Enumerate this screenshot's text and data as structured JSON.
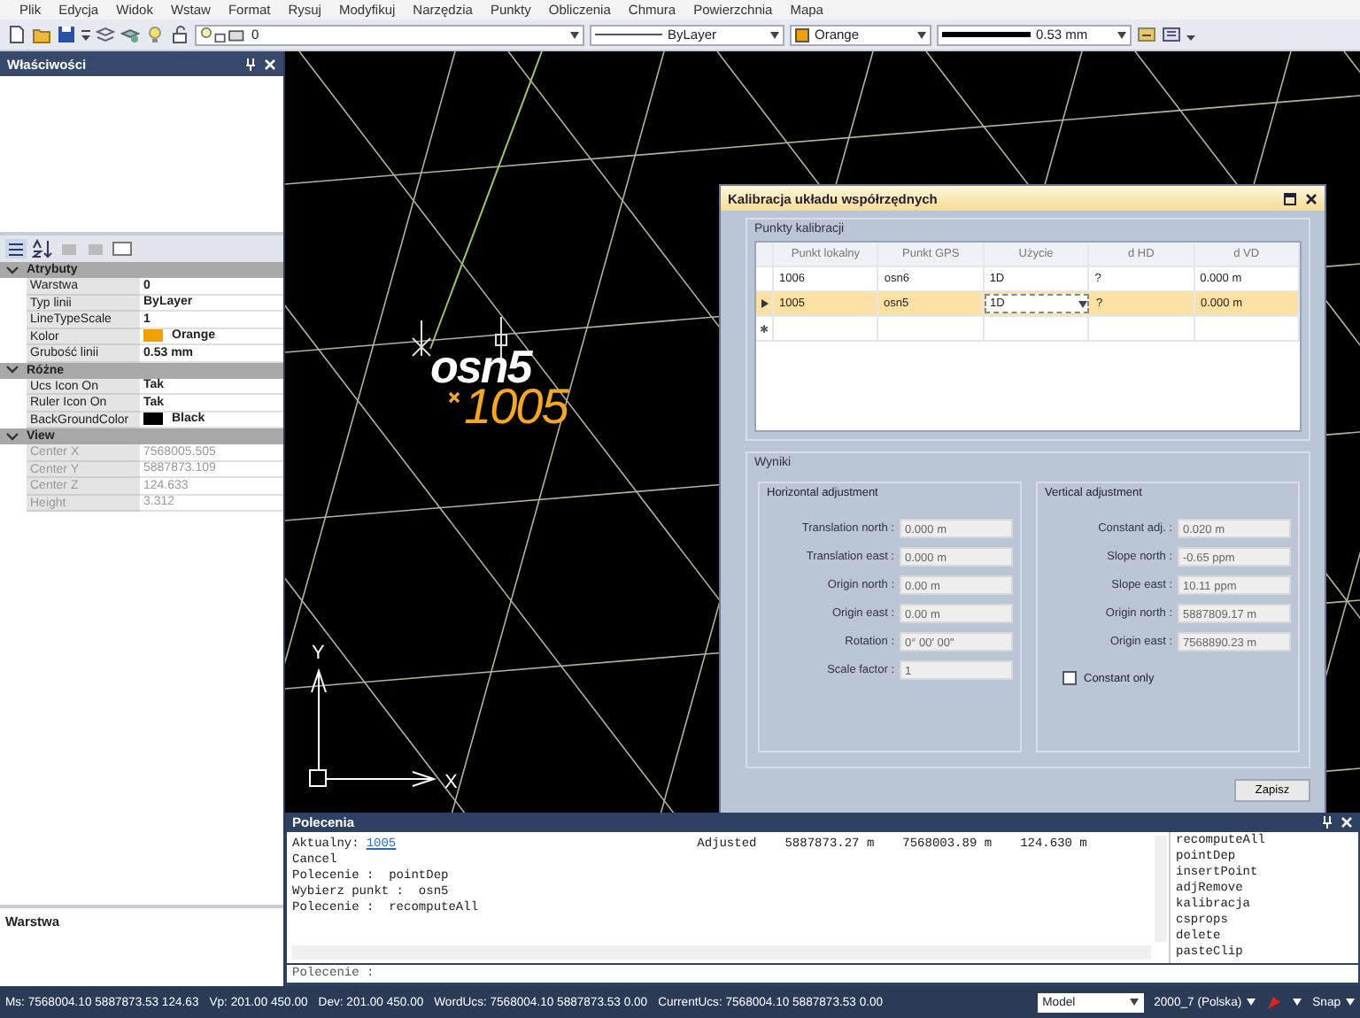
{
  "menu": [
    "Plik",
    "Edycja",
    "Widok",
    "Wstaw",
    "Format",
    "Rysuj",
    "Modyfikuj",
    "Narzędzia",
    "Punkty",
    "Obliczenia",
    "Chmura",
    "Powierzchnia",
    "Mapa"
  ],
  "toolbar": {
    "combos": [
      {
        "kind": "layer",
        "value": "0"
      },
      {
        "kind": "linetype",
        "value": "ByLayer"
      },
      {
        "kind": "color",
        "value": "Orange",
        "color": "#f0a000"
      },
      {
        "kind": "lineweight",
        "value": "0.53 mm"
      }
    ]
  },
  "properties": {
    "title": "Właściwości",
    "sections": [
      {
        "title": "Atrybuty",
        "expanded": true,
        "rows": [
          {
            "name": "Warstwa",
            "value": "0",
            "disabled": false
          },
          {
            "name": "Typ linii",
            "value": "ByLayer",
            "disabled": false
          },
          {
            "name": "LineTypeScale",
            "value": "1",
            "disabled": false
          },
          {
            "name": "Kolor",
            "value": "Orange",
            "disabled": false,
            "color": "#f0a000"
          },
          {
            "name": "Grubość linii",
            "value": "0.53 mm",
            "disabled": false
          }
        ]
      },
      {
        "title": "Różne",
        "expanded": true,
        "rows": [
          {
            "name": "Ucs Icon On",
            "value": "Tak",
            "disabled": false
          },
          {
            "name": "Ruler Icon On",
            "value": "Tak",
            "disabled": false
          },
          {
            "name": "BackGroundColor",
            "value": "Black",
            "disabled": false,
            "color": "#000000"
          }
        ]
      },
      {
        "title": "View",
        "expanded": true,
        "rows": [
          {
            "name": "Center X",
            "value": "7568005.505",
            "disabled": true
          },
          {
            "name": "Center Y",
            "value": "5887873.109",
            "disabled": true
          },
          {
            "name": "Center Z",
            "value": "124.633",
            "disabled": true
          },
          {
            "name": "Height",
            "value": "3.312",
            "disabled": true
          }
        ]
      }
    ]
  },
  "layer_panel": {
    "title": "Warstwa"
  },
  "canvas": {
    "point_name": "osn5",
    "point_number": "1005",
    "axis_y": "Y",
    "axis_x": "X"
  },
  "dialog": {
    "title": "Kalibracja układu współrzędnych",
    "points": {
      "title": "Punkty kalibracji",
      "columns": [
        "Punkt lokalny",
        "Punkt GPS",
        "Użycie",
        "d HD",
        "d VD"
      ],
      "rows": [
        {
          "selected": false,
          "usage_dropdown": false,
          "cells": [
            "1006",
            "osn6",
            "1D",
            "?",
            "0.000 m"
          ]
        },
        {
          "selected": true,
          "usage_dropdown": true,
          "cells": [
            "1005",
            "osn5",
            "1D",
            "?",
            "0.000 m"
          ]
        }
      ],
      "new_row_marker": "✱"
    },
    "results": {
      "title": "Wyniki",
      "horizontal": {
        "title": "Horizontal adjustment",
        "fields": [
          {
            "label": "Translation north :",
            "value": "0.000 m"
          },
          {
            "label": "Translation east :",
            "value": "0.000 m"
          },
          {
            "label": "Origin north :",
            "value": "0.00 m"
          },
          {
            "label": "Origin east :",
            "value": "0.00 m"
          },
          {
            "label": "Rotation :",
            "value": "0° 00' 00\""
          },
          {
            "label": "Scale factor :",
            "value": "1"
          }
        ]
      },
      "vertical": {
        "title": "Vertical adjustment",
        "fields": [
          {
            "label": "Constant adj. :",
            "value": "0.020 m"
          },
          {
            "label": "Slope north :",
            "value": "-0.65 ppm"
          },
          {
            "label": "Slope east :",
            "value": "10.11 ppm"
          },
          {
            "label": "Origin north :",
            "value": "5887809.17 m"
          },
          {
            "label": "Origin east :",
            "value": "7568890.23 m"
          }
        ],
        "checkbox": {
          "label": "Constant only",
          "checked": false
        }
      }
    },
    "button": "Zapisz"
  },
  "commands": {
    "title": "Polecenia",
    "header": {
      "label": "Aktualny:",
      "link": "1005",
      "columns": [
        "Adjusted",
        "5887873.27 m",
        "7568003.89 m",
        "124.630 m"
      ]
    },
    "lines": [
      "Cancel",
      "Polecenie :  pointDep",
      "Wybierz punkt :  osn5",
      "Polecenie :  recomputeAll"
    ],
    "history": [
      "recomputeAll",
      "pointDep",
      "insertPoint",
      "adjRemove",
      "kalibracja",
      "csprops",
      "delete",
      "pasteClip"
    ],
    "placeholder": "Polecenie :"
  },
  "status_bar": {
    "coords": [
      "Ms: 7568004.10 5887873.53 124.63",
      "Vp: 201.00 450.00",
      "Dev: 201.00 450.00",
      "WordUcs: 7568004.10 5887873.53 0.00",
      "CurrentUcs: 7568004.10 5887873.53 0.00"
    ],
    "space": "Model",
    "language": "2000_7 (Polska)",
    "snap": "Snap"
  }
}
